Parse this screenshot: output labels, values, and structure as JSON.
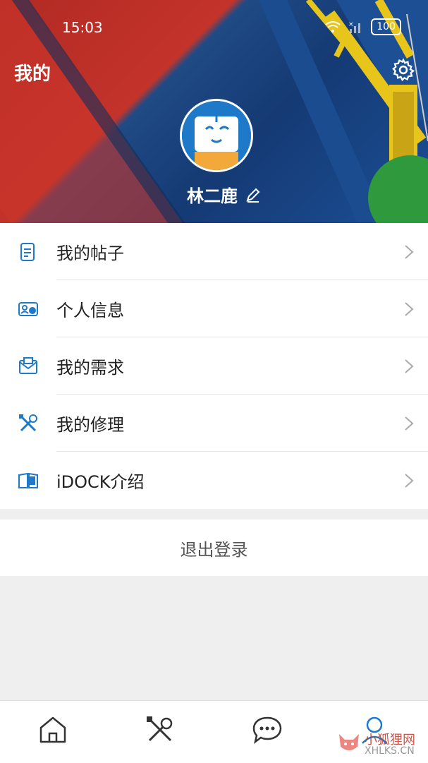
{
  "status_bar": {
    "time": "15:03",
    "battery": "100"
  },
  "header": {
    "title": "我的",
    "user_name": "林二鹿"
  },
  "menu": {
    "items": [
      {
        "label": "我的帖子",
        "icon": "document-icon"
      },
      {
        "label": "个人信息",
        "icon": "id-card-icon"
      },
      {
        "label": "我的需求",
        "icon": "mail-icon"
      },
      {
        "label": "我的修理",
        "icon": "tools-icon"
      },
      {
        "label": "iDOCK介绍",
        "icon": "book-icon"
      }
    ]
  },
  "logout": {
    "label": "退出登录"
  },
  "tabbar": {
    "tabs": [
      {
        "name": "home-tab",
        "icon": "home-icon"
      },
      {
        "name": "repair-tab",
        "icon": "tools-icon"
      },
      {
        "name": "messages-tab",
        "icon": "chat-icon"
      },
      {
        "name": "profile-tab",
        "icon": "user-icon"
      }
    ]
  },
  "watermark": {
    "title": "小狐狸网",
    "subtitle": "XHLKS.CN"
  },
  "colors": {
    "accent": "#1e79c9",
    "text": "#222222",
    "background": "#efefef"
  }
}
